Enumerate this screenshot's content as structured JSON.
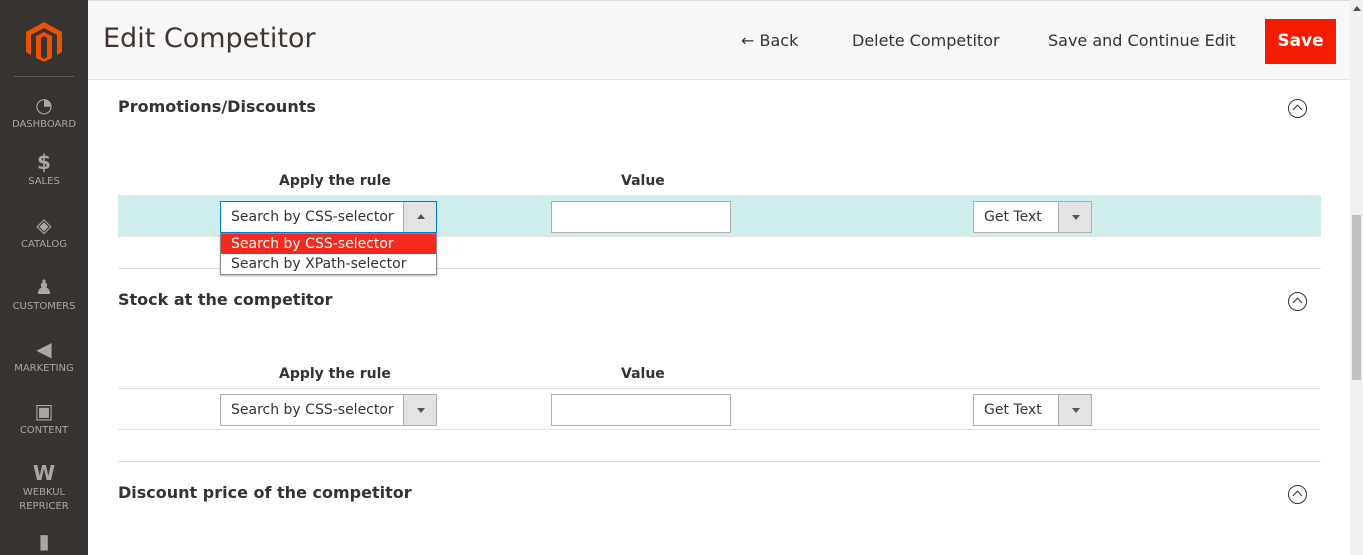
{
  "sidebar": {
    "items": [
      {
        "label": "DASHBOARD",
        "icon": "dashboard-icon"
      },
      {
        "label": "SALES",
        "icon": "dollar-icon"
      },
      {
        "label": "CATALOG",
        "icon": "box-icon"
      },
      {
        "label": "CUSTOMERS",
        "icon": "person-icon"
      },
      {
        "label": "MARKETING",
        "icon": "megaphone-icon"
      },
      {
        "label": "CONTENT",
        "icon": "layout-icon"
      },
      {
        "label": "WEBKUL REPRICER",
        "icon": "webkul-icon"
      },
      {
        "label": "",
        "icon": "reports-icon"
      }
    ]
  },
  "header": {
    "title": "Edit Competitor",
    "back": "Back",
    "delete": "Delete Competitor",
    "save_continue": "Save and Continue Edit",
    "save": "Save"
  },
  "colors": {
    "accent": "#eb5202",
    "save": "#f31c00",
    "highlight_row": "#cdeeec"
  },
  "sections": [
    {
      "title": "Promotions/Discounts",
      "col_rule": "Apply the rule",
      "col_value": "Value",
      "rule": "Search by CSS-selector",
      "value": "",
      "action": "Get Text",
      "dropdown": {
        "options": [
          "Search by CSS-selector",
          "Search by XPath-selector"
        ]
      }
    },
    {
      "title": "Stock at the competitor",
      "col_rule": "Apply the rule",
      "col_value": "Value",
      "rule": "Search by CSS-selector",
      "value": "",
      "action": "Get Text"
    },
    {
      "title": "Discount price of the competitor"
    }
  ]
}
